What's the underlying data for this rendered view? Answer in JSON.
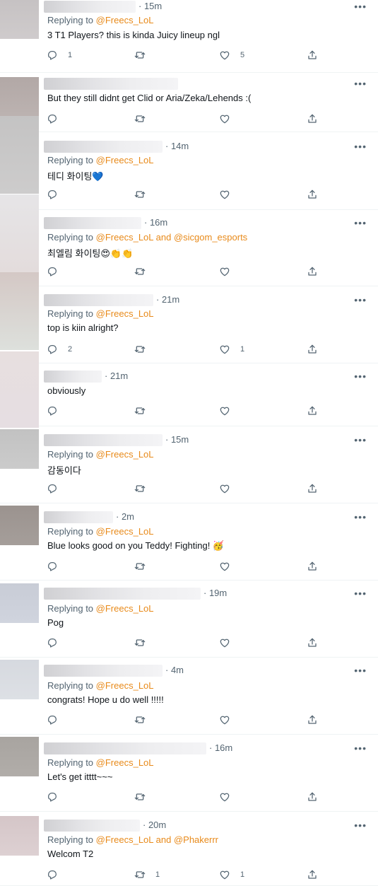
{
  "tweets": [
    {
      "time": "15m",
      "reply_prefix": "Replying to",
      "reply_to": "@Freecs_LoL",
      "text": "3 T1 Players? this is kinda Juicy lineup ngl",
      "replies": "1",
      "retweets": "",
      "likes": "5"
    },
    {
      "time": "",
      "reply_prefix": "",
      "reply_to": "",
      "text": "But they still didnt get Clid or Aria/Zeka/Lehends :(",
      "replies": "",
      "retweets": "",
      "likes": ""
    },
    {
      "time": "14m",
      "reply_prefix": "Replying to",
      "reply_to": "@Freecs_LoL",
      "text": "테디 화이팅💙",
      "replies": "",
      "retweets": "",
      "likes": ""
    },
    {
      "time": "16m",
      "reply_prefix": "Replying to",
      "reply_to": "@Freecs_LoL and @sicgom_esports",
      "text": "최엘림 화이팅😍👏👏",
      "replies": "",
      "retweets": "",
      "likes": ""
    },
    {
      "time": "21m",
      "reply_prefix": "Replying to",
      "reply_to": "@Freecs_LoL",
      "text": "top is kiin alright?",
      "replies": "2",
      "retweets": "",
      "likes": "1"
    },
    {
      "time": "21m",
      "reply_prefix": "",
      "reply_to": "",
      "text": "obviously",
      "replies": "",
      "retweets": "",
      "likes": ""
    },
    {
      "time": "15m",
      "reply_prefix": "Replying to",
      "reply_to": "@Freecs_LoL",
      "text": "감동이다",
      "replies": "",
      "retweets": "",
      "likes": ""
    },
    {
      "time": "2m",
      "reply_prefix": "Replying to",
      "reply_to": "@Freecs_LoL",
      "text": "Blue looks good on you Teddy! Fighting! 🥳",
      "replies": "",
      "retweets": "",
      "likes": ""
    },
    {
      "time": "19m",
      "reply_prefix": "Replying to",
      "reply_to": "@Freecs_LoL",
      "text": "Pog",
      "replies": "",
      "retweets": "",
      "likes": ""
    },
    {
      "time": "4m",
      "reply_prefix": "Replying to",
      "reply_to": "@Freecs_LoL",
      "text": "congrats! Hope u do well !!!!!",
      "replies": "",
      "retweets": "",
      "likes": ""
    },
    {
      "time": "16m",
      "reply_prefix": "Replying to",
      "reply_to": "@Freecs_LoL",
      "text": "Let's get itttt~~~",
      "replies": "",
      "retweets": "",
      "likes": ""
    },
    {
      "time": "20m",
      "reply_prefix": "Replying to",
      "reply_to": "@Freecs_LoL and @Phakerrr",
      "text": "Welcom T2",
      "replies": "",
      "retweets": "1",
      "likes": "1"
    }
  ],
  "icons": {
    "reply": "reply-icon",
    "retweet": "retweet-icon",
    "like": "heart-icon",
    "share": "share-icon",
    "more": "more-icon"
  },
  "colors": {
    "mention": "#e88a1a",
    "muted": "#536471",
    "text": "#0f1419",
    "divider": "#eff3f4"
  }
}
